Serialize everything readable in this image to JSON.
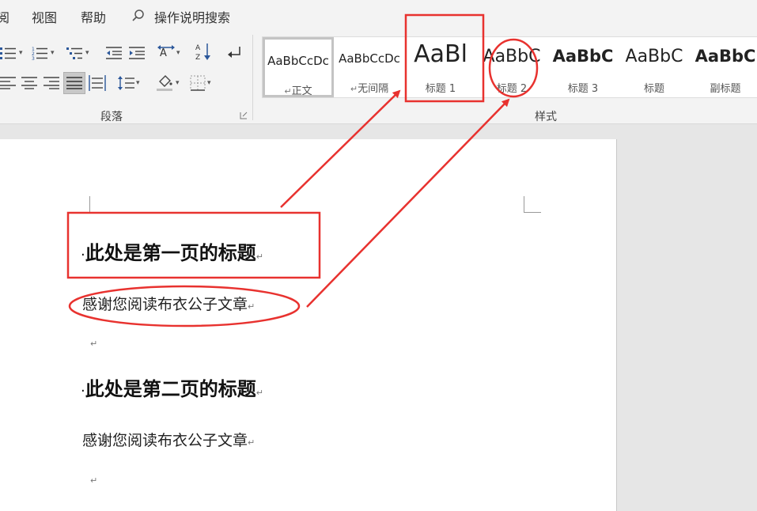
{
  "menu": {
    "items": [
      "阅",
      "视图",
      "帮助"
    ],
    "search_label": "操作说明搜索"
  },
  "ribbon": {
    "paragraph_group_label": "段落",
    "styles_group_label": "样式",
    "styles": [
      {
        "preview": "AaBbCcDc",
        "name": "正文",
        "selected": true
      },
      {
        "preview": "AaBbCcDc",
        "name": "无间隔",
        "selected": false
      },
      {
        "preview": "AaBl",
        "name": "标题 1",
        "selected": false
      },
      {
        "preview": "AaBbC",
        "name": "标题 2",
        "selected": false
      },
      {
        "preview": "AaBbC",
        "name": "标题 3",
        "selected": false
      },
      {
        "preview": "AaBbC",
        "name": "标题",
        "selected": false
      },
      {
        "preview": "AaBbC",
        "name": "副标题",
        "selected": false
      }
    ]
  },
  "document": {
    "heading_1": "此处是第一页的标题",
    "body_1": "感谢您阅读布衣公子文章",
    "heading_2": "此处是第二页的标题",
    "body_2": "感谢您阅读布衣公子文章",
    "paragraph_mark": "↵",
    "bullet_mark": "·"
  },
  "colors": {
    "annotation": "#e8322f",
    "ribbon_bg": "#f3f3f3",
    "canvas_bg": "#e6e6e6"
  }
}
